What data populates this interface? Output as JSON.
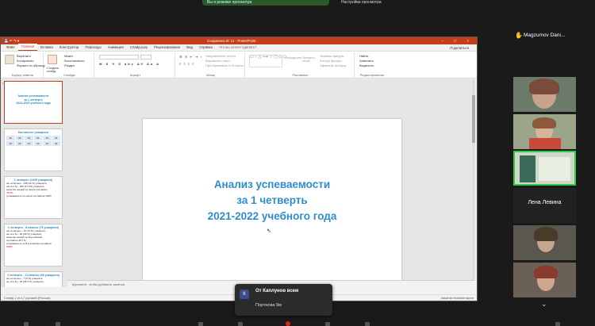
{
  "zoom": {
    "pill_text": "Вы в режиме просмотра",
    "view_label": "Настройки просмотра"
  },
  "ppt": {
    "doc_title": "Сохранено В: 11 - PowerPoint",
    "tabs": [
      "Файл",
      "Главная",
      "Вставка",
      "Конструктор",
      "Переходы",
      "Анимация",
      "Слайд-шоу",
      "Рецензирование",
      "Вид",
      "Справка"
    ],
    "active_tab": "Главная",
    "tell_me": "Что вы хотите сделать?",
    "share": "Поделиться",
    "ribbon_groups": [
      "Буфер обмена",
      "Слайды",
      "Шрифт",
      "Абзац",
      "Рисование",
      "Редактирование"
    ],
    "clipboard": {
      "cut": "Вырезать",
      "copy": "Копировать",
      "format": "Формат по образцу"
    },
    "slides_grp": {
      "new_slide": "Создать слайд",
      "layout": "Макет",
      "reset": "Восстановить",
      "section": "Раздел"
    },
    "editing": {
      "find": "Найти",
      "replace": "Заменить",
      "select": "Выделить"
    },
    "paragraph_items": [
      "Направление текста",
      "Выровнять текст",
      "Преобразовать в SmartArt"
    ],
    "drawing_items": [
      "Упорядочить",
      "Экспресс-стили",
      "Заливка фигуры",
      "Контур фигуры",
      "Эффекты фигуры"
    ],
    "slide_title_lines": [
      "Анализ успеваемости",
      "за 1 четверть",
      "2021-2022 учебного года"
    ],
    "notes_placeholder": "Щелкните, чтобы добавить заметки",
    "status_left": "Слайд 1 из 17   русский (Россия)",
    "status_right": "Заметки   Комментарии",
    "thumbs": {
      "t1": [
        "Анализ успеваемости",
        "за 1 четверть",
        "2021-2022 учебного года"
      ],
      "t2_title": "Контингент учащихся",
      "t2_values": [
        "23",
        "24",
        "23",
        "24",
        "23",
        "24",
        "23",
        "23",
        "24",
        "22",
        "23",
        "24"
      ],
      "t3_title": "1 четверть (1045 учащихся)",
      "t3_lines": [
        "на «отлично» - 148 (14 %) учащихся,",
        "на «4 и 5» - 400 (47,3%) учащихся",
        "качество знаний по школе составило",
        "78,3%",
        "успеваемость по школе составила 100%"
      ],
      "t4_title": "1 четверть - 8 классы (75 учащихся)",
      "t4_lines": [
        "на «отлично» - 10 (14 %) учащихся,",
        "на «4 и 5» - 20 (28 %) учащихся,",
        "качество знаний по 8-м классам",
        "составило 45,7 %.",
        "успеваемость по 8-м классам составила",
        "100%"
      ],
      "t5_title": "1 четверть - 11 классы (35 учащихся)",
      "t5_lines": [
        "на «отлично» - 7 (3 %) учащихся,",
        "на «4 и 5» - 16 (45,4 %) учащихся"
      ]
    }
  },
  "participants": {
    "top_name": "Magzumov Dani...",
    "center_name": "Лена Левина"
  },
  "chat": {
    "avatar_letter": "К",
    "from": "От Каплунов всем",
    "message": "Портнова 9м"
  },
  "colors": {
    "ppt_accent": "#c43e1c",
    "slide_title": "#2f8ccc",
    "active_speaker": "#2ecc40"
  }
}
